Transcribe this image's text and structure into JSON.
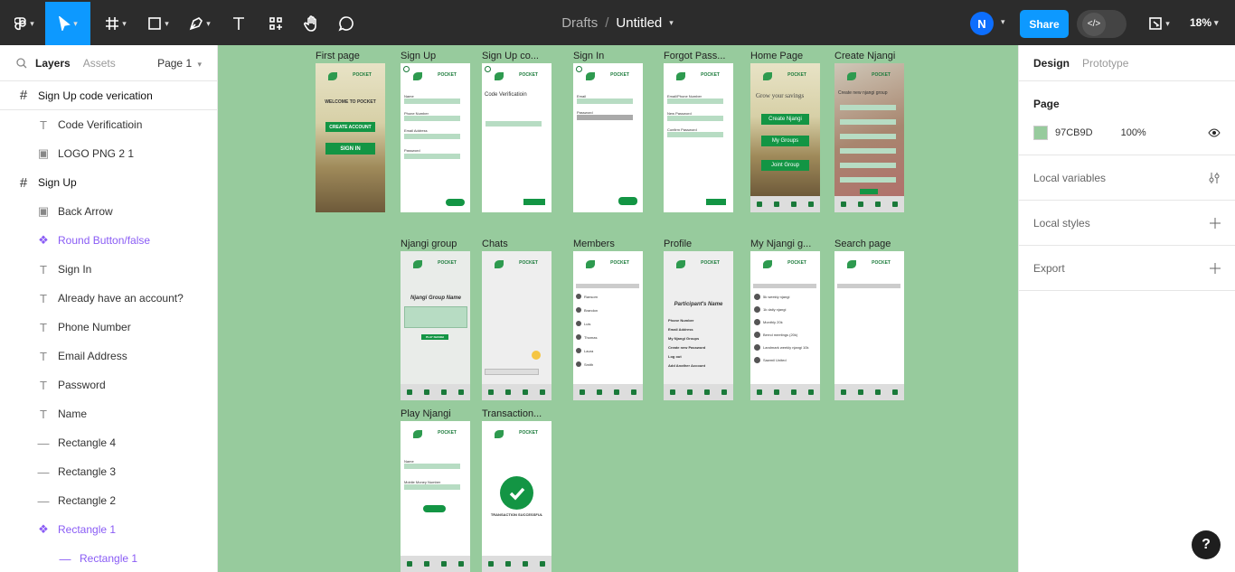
{
  "topbar": {
    "breadcrumb_root": "Drafts",
    "breadcrumb_sep": "/",
    "file_name": "Untitled",
    "share_label": "Share",
    "user_initial": "N",
    "zoom": "18%",
    "caret": "▾",
    "dev_mode_icon": "</>"
  },
  "left": {
    "tab_layers": "Layers",
    "tab_assets": "Assets",
    "page_select": "Page 1",
    "layers": [
      {
        "name": "Sign Up code verication",
        "kind": "frame",
        "icon": "#"
      },
      {
        "name": "Code Verificatioin",
        "kind": "text",
        "icon": "T"
      },
      {
        "name": "LOGO PNG 2 1",
        "kind": "image",
        "icon": "▣"
      },
      {
        "name": "Sign Up",
        "kind": "frame",
        "icon": "#"
      },
      {
        "name": "Back Arrow",
        "kind": "image",
        "icon": "▣"
      },
      {
        "name": "Round Button/false",
        "kind": "component",
        "icon": "❖"
      },
      {
        "name": "Sign In",
        "kind": "text",
        "icon": "T"
      },
      {
        "name": "Already have an account?",
        "kind": "text",
        "icon": "T"
      },
      {
        "name": "Phone Number",
        "kind": "text",
        "icon": "T"
      },
      {
        "name": "Email Address",
        "kind": "text",
        "icon": "T"
      },
      {
        "name": "Password",
        "kind": "text",
        "icon": "T"
      },
      {
        "name": "Name",
        "kind": "text",
        "icon": "T"
      },
      {
        "name": "Rectangle 4",
        "kind": "line",
        "icon": "—"
      },
      {
        "name": "Rectangle 3",
        "kind": "line",
        "icon": "—"
      },
      {
        "name": "Rectangle 2",
        "kind": "line",
        "icon": "—"
      },
      {
        "name": "Rectangle 1",
        "kind": "component",
        "icon": "❖"
      },
      {
        "name": "Rectangle 1",
        "kind": "component-line",
        "icon": "—"
      }
    ]
  },
  "canvas": {
    "bg": "#97CB9D",
    "frames": [
      "First page",
      "Sign Up",
      "Sign Up co...",
      "Sign In",
      "Forgot Pass...",
      "Home Page",
      "Create Njangi",
      "Njangi group",
      "Chats",
      "Members",
      "Profile",
      "My Njangi g...",
      "Search page",
      "Play Njangi",
      "Transaction..."
    ],
    "first_page": {
      "welcome": "WELCOME TO POCKET",
      "create": "CREATE ACCOUNT",
      "signin": "SIGN IN"
    },
    "logo": "POCKET",
    "home": {
      "tagline": "Grow your savings",
      "create": "Create Njangi",
      "groups": "My Groups",
      "join": "Joint Group"
    },
    "create_njangi_title": "Create new njangi group",
    "group_name": "Njangi Group Name",
    "participant": "Participant's Name",
    "code_title": "Code Verificatioin",
    "transaction": "TRANSACTION SUCCESSFUL",
    "play_button": "PLAY NJANGI",
    "signup_fields": [
      "Name",
      "Phone Number",
      "Email Address",
      "Password"
    ],
    "signin_fields": [
      "Email",
      "Password"
    ],
    "forgot_fields": [
      "Email/Phone Number",
      "New Password",
      "Confirm Password"
    ],
    "play_fields": [
      "Name",
      "Mobile Money Number"
    ],
    "profile_items": [
      "Phone Number",
      "Email Address",
      "My Njangi Groups",
      "Create new Password",
      "Log out",
      "Add Another Account"
    ],
    "my_groups": [
      "5k weekly njangi",
      "1k daily njangi",
      "Monthly 20k",
      "Bernd meetings (20k)",
      "Landmark weekly njangi 10k",
      "Sawmil United"
    ],
    "members": [
      "Ransom",
      "Brandon",
      "Luis",
      "Thomas",
      "Laura",
      "Smith"
    ]
  },
  "right": {
    "tab_design": "Design",
    "tab_prototype": "Prototype",
    "page_heading": "Page",
    "page_color_hex": "97CB9D",
    "page_opacity": "100%",
    "local_variables": "Local variables",
    "local_styles": "Local styles",
    "export": "Export",
    "help": "?"
  }
}
